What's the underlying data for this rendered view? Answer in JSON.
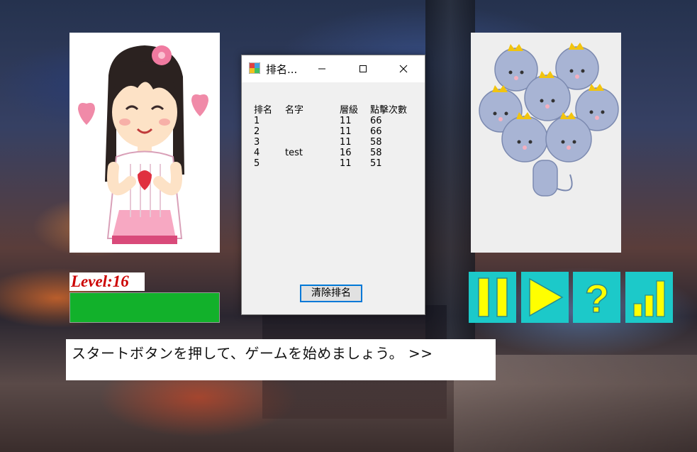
{
  "dialog": {
    "title": "排名...",
    "headers": {
      "rank": "排名",
      "name": "名字",
      "level": "層級",
      "clicks": "點擊次數"
    },
    "rows": [
      {
        "rank": "1",
        "name": "",
        "level": "11",
        "clicks": "66"
      },
      {
        "rank": "2",
        "name": "",
        "level": "11",
        "clicks": "66"
      },
      {
        "rank": "3",
        "name": "",
        "level": "11",
        "clicks": "58"
      },
      {
        "rank": "4",
        "name": "test",
        "level": "16",
        "clicks": "58"
      },
      {
        "rank": "5",
        "name": "",
        "level": "11",
        "clicks": "51"
      }
    ],
    "clear_button_label": "清除排名",
    "window_buttons": [
      "minimize-icon",
      "maximize-icon",
      "close-icon"
    ]
  },
  "game": {
    "level_label": "Level:16",
    "progress": 1.0,
    "message": "スタートボタンを押して、ゲームを始めましょう。 >>",
    "controls": [
      {
        "name": "pause-icon"
      },
      {
        "name": "play-icon"
      },
      {
        "name": "help-icon"
      },
      {
        "name": "ranking-icon"
      }
    ]
  },
  "colors": {
    "control_bg": "#1cc9c9",
    "control_icon": "#ffff00",
    "progress_fill": "#12b12b",
    "level_text": "#cc0000",
    "focus_border": "#0078d7"
  }
}
